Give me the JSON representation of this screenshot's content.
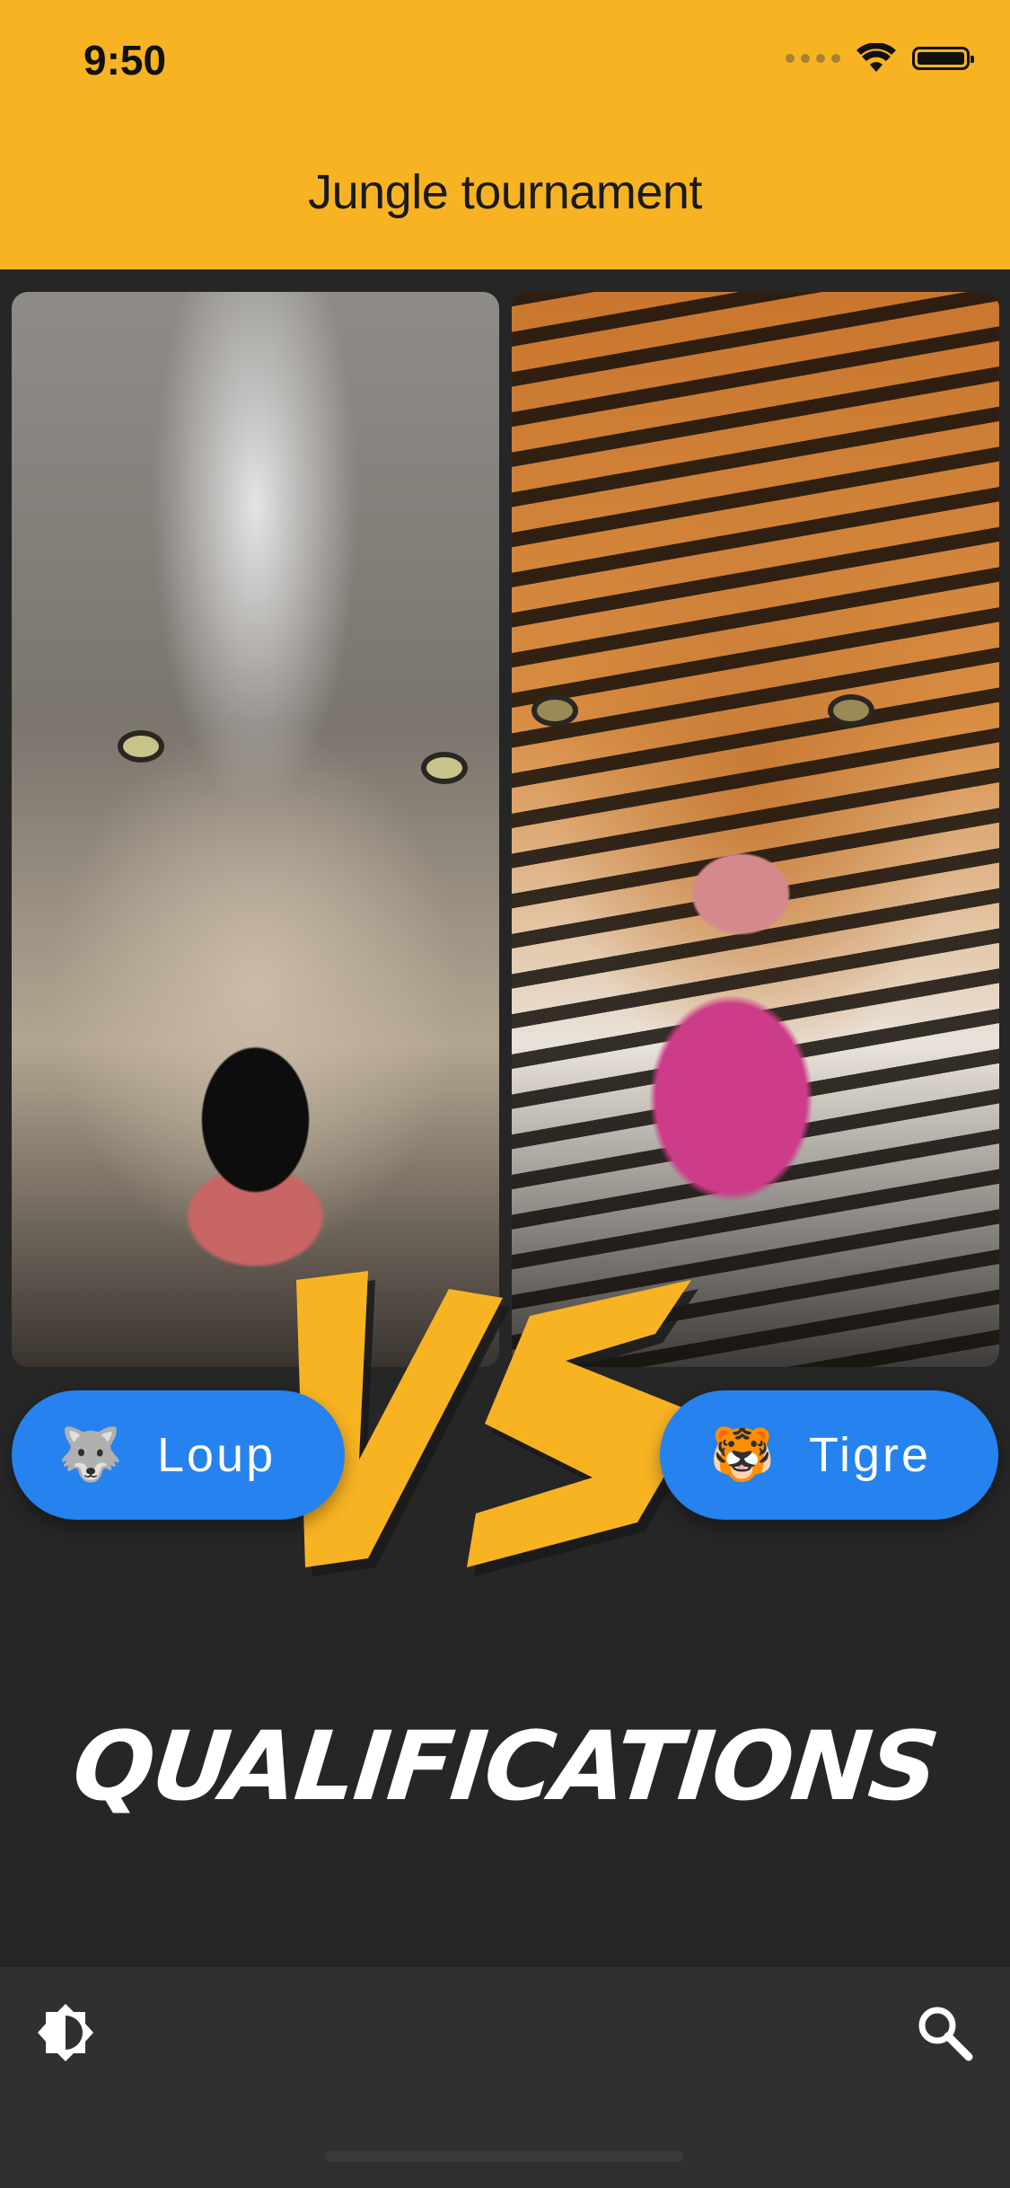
{
  "status_bar": {
    "time": "9:50",
    "icons": [
      "signal-icon",
      "wifi-icon",
      "battery-icon"
    ]
  },
  "app_bar": {
    "title": "Jungle tournament",
    "color": "#F8B323"
  },
  "match": {
    "left": {
      "name": "Loup",
      "emoji": "🐺",
      "image": "wolf-photo"
    },
    "right": {
      "name": "Tigre",
      "emoji": "🐯",
      "image": "tiger-photo"
    },
    "button_color": "#2582EE",
    "vs_color": "#F8B323"
  },
  "round": {
    "label": "QUALIFICATIONS"
  },
  "bottom_bar": {
    "left_icon": "brightness-icon",
    "right_icon": "search-icon"
  }
}
